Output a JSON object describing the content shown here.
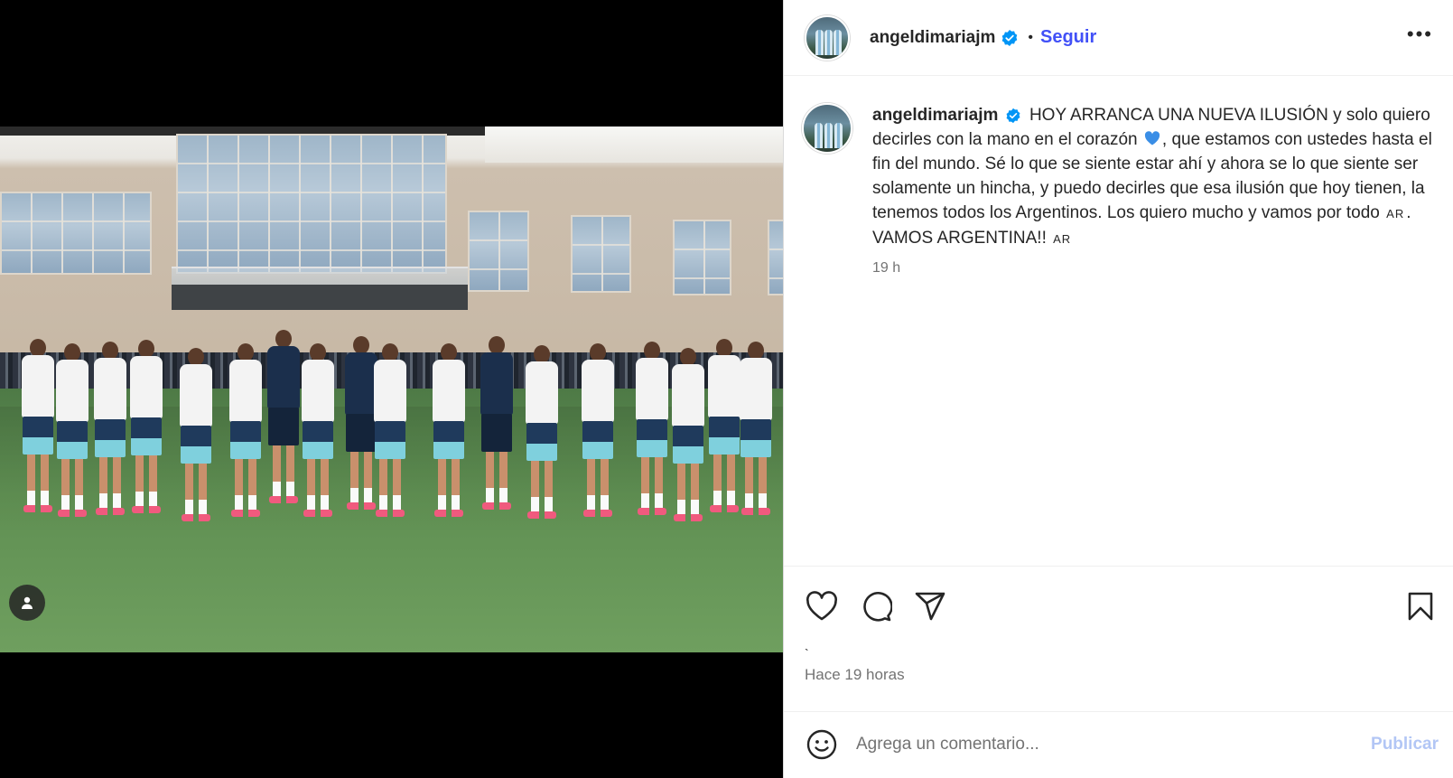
{
  "post": {
    "username": "angeldimariajm",
    "follow_label": "Seguir",
    "separator": "•",
    "more_label": "•••",
    "caption_username": "angeldimariajm",
    "caption_part1": "HOY ARRANCA UNA NUEVA ILUSIÓN y solo quiero decirles con la mano en el corazón",
    "caption_part2": ", que estamos con ustedes hasta el fin del mundo. Sé lo que se siente estar ahí y ahora se lo que siente ser solamente un hincha, y puedo decirles que esa ilusión que hoy tienen, la tenemos todos los Argentinos. Los quiero mucho y vamos por todo",
    "flag1": "AR",
    "caption_part3": ". VAMOS ARGENTINA!!",
    "flag2": "AR",
    "caption_time": "19 h",
    "likes_text": "`",
    "ago_text": "Hace 19 horas",
    "comment_placeholder": "Agrega un comentario...",
    "publish_label": "Publicar"
  },
  "colors": {
    "link_blue": "#4150f7",
    "verified_blue": "#0095f6",
    "publish_disabled": "#b2c6f5",
    "heart_blue": "#3a8ee6"
  },
  "icons": [
    "user-tag-icon",
    "verified-icon",
    "more-options-icon",
    "like-icon",
    "comment-icon",
    "share-icon",
    "save-icon",
    "emoji-icon",
    "blue-heart-emoji"
  ]
}
